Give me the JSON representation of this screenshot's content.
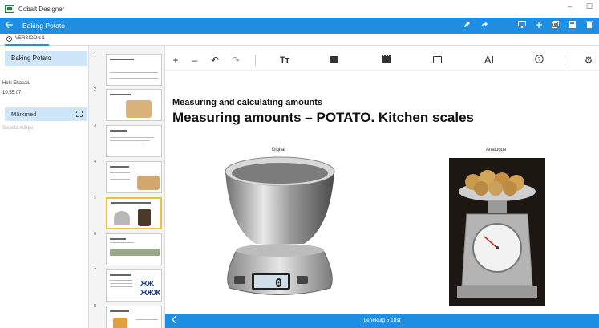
{
  "window": {
    "app_title": "Cobalt Designer",
    "minimize": "–",
    "maximize": "☐"
  },
  "header": {
    "back_icon": "arrow-left-icon",
    "doc_title": "Baking Potato"
  },
  "version_tab": {
    "label": "VERSIOON 1"
  },
  "sidebar": {
    "doc_name": "Baking Potato",
    "author": "Helli Ehasalu",
    "time": "10:55:07",
    "notes_label": "Märkmed",
    "notes_placeholder": "Sisesta märge"
  },
  "thumbnails": [
    {
      "num": "1",
      "title": "Bake the potato"
    },
    {
      "num": "2",
      "title": "Baking Potato"
    },
    {
      "num": "3",
      "title": "Introduction"
    },
    {
      "num": "4",
      "title": "We use items"
    },
    {
      "num": "5",
      "title": "Measuring and calculating"
    },
    {
      "num": "6",
      "title": "Measuring potatoes"
    },
    {
      "num": "7",
      "title": "Calculating amounts"
    },
    {
      "num": "8",
      "title": "Add + Increasing"
    }
  ],
  "toolbar": {
    "add": "+",
    "remove": "–",
    "undo": "↶",
    "redo": "↷",
    "text": "Tт",
    "textsize": "AI",
    "help": "?",
    "settings": "⚙"
  },
  "slide": {
    "subtitle": "Measuring and calculating amounts",
    "title": "Measuring amounts – POTATO. Kitchen scales",
    "caption_digital": "Digital",
    "caption_analogue": "Analogue",
    "display_value": "0"
  },
  "status": {
    "page_info": "Lehekülg 5 18st",
    "prev_icon": "chevron-left-icon"
  },
  "colors": {
    "accent": "#1e8fe3",
    "active_thumb": "#f0c040",
    "sidebar_highlight": "#cfe5f8"
  }
}
